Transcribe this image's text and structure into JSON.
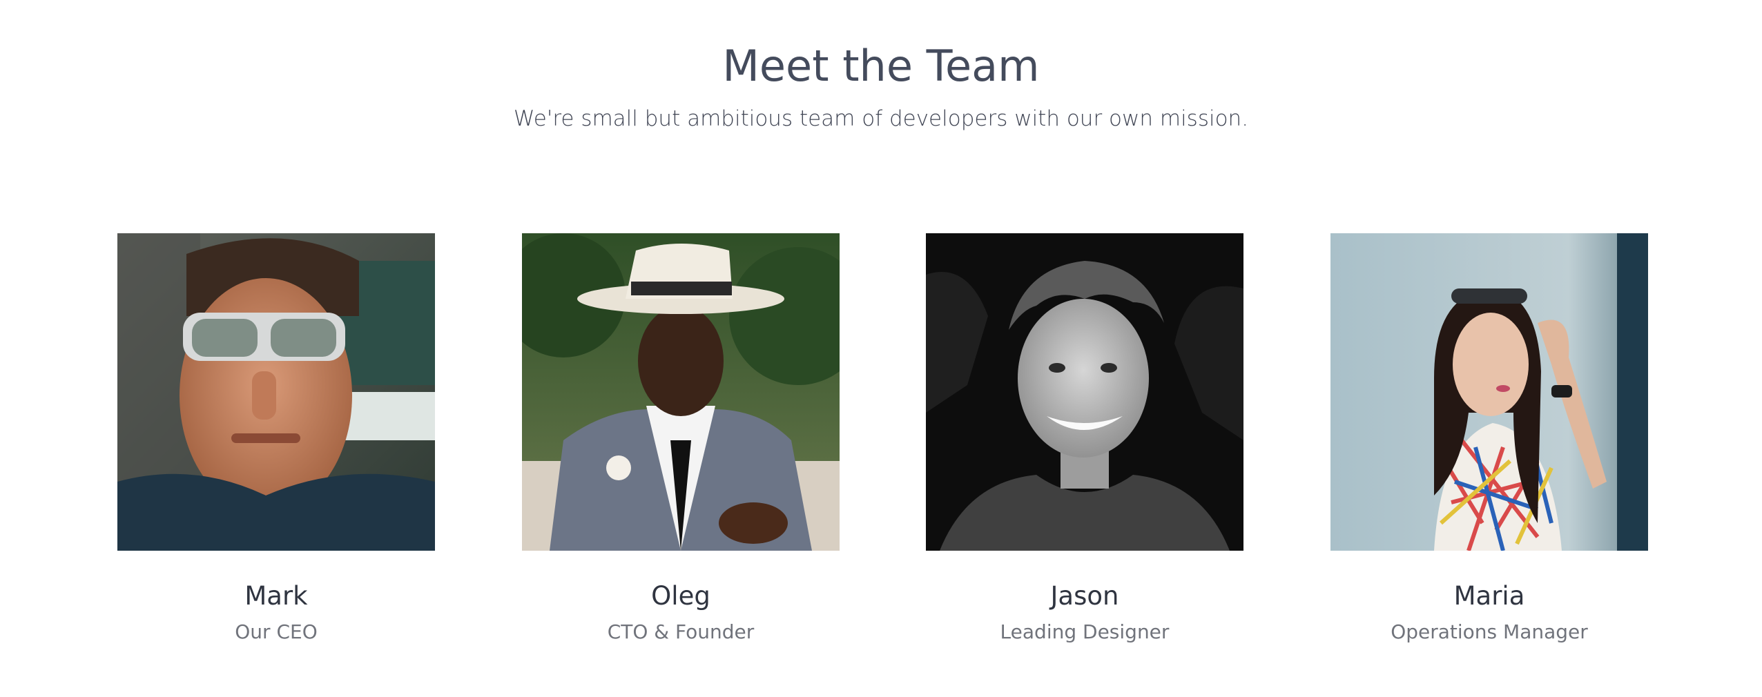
{
  "section": {
    "title": "Meet the Team",
    "subtitle": "We're small but ambitious team of developers with our own mission."
  },
  "team": [
    {
      "name": "Mark",
      "role": "Our CEO",
      "photo_icon": "portrait-man-sunglasses"
    },
    {
      "name": "Oleg",
      "role": "CTO & Founder",
      "photo_icon": "portrait-man-hat"
    },
    {
      "name": "Jason",
      "role": "Leading Designer",
      "photo_icon": "portrait-man-smiling-bw"
    },
    {
      "name": "Maria",
      "role": "Operations Manager",
      "photo_icon": "portrait-woman-sunglasses-on-head"
    }
  ]
}
